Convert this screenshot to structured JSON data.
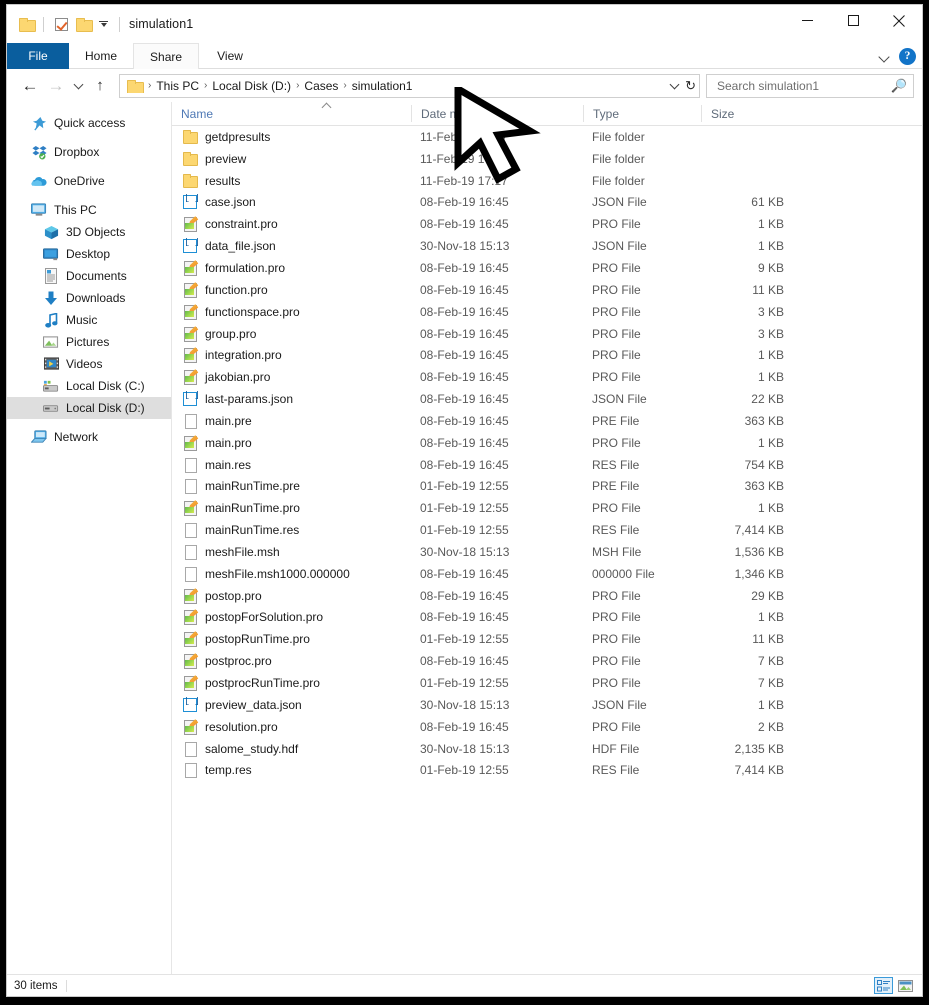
{
  "window": {
    "title": "simulation1",
    "quick_access": [
      "folder-icon",
      "properties-checkbox-icon",
      "new-folder-icon",
      "customize-chevron-icon"
    ],
    "controls": {
      "minimize": "–",
      "maximize": "☐",
      "close": "✕"
    }
  },
  "ribbon": {
    "tabs": [
      {
        "label": "File",
        "state": "file"
      },
      {
        "label": "Home",
        "state": "normal"
      },
      {
        "label": "Share",
        "state": "hover"
      },
      {
        "label": "View",
        "state": "normal"
      }
    ],
    "collapse_label": "⌄",
    "help_label": "?"
  },
  "address": {
    "back": "←",
    "forward": "→",
    "recent_caret": "⌄",
    "up": "↑",
    "crumbs": [
      "This PC",
      "Local Disk (D:)",
      "Cases",
      "simulation1"
    ],
    "separator": "›",
    "refresh": "↻"
  },
  "search": {
    "placeholder": "Search simulation1",
    "value": "",
    "icon": "search-icon"
  },
  "sidebar": {
    "items": [
      {
        "label": "Quick access",
        "icon": "pin-icon",
        "indent": false,
        "selected": false,
        "gap": false
      },
      {
        "label": "Dropbox",
        "icon": "dropbox-icon",
        "indent": false,
        "selected": false,
        "gap": true
      },
      {
        "label": "OneDrive",
        "icon": "onedrive-cloud-icon",
        "indent": false,
        "selected": false,
        "gap": true
      },
      {
        "label": "This PC",
        "icon": "monitor-icon",
        "indent": false,
        "selected": false,
        "gap": true
      },
      {
        "label": "3D Objects",
        "icon": "3d-objects-icon",
        "indent": true,
        "selected": false,
        "gap": false
      },
      {
        "label": "Desktop",
        "icon": "desktop-icon",
        "indent": true,
        "selected": false,
        "gap": false
      },
      {
        "label": "Documents",
        "icon": "documents-icon",
        "indent": true,
        "selected": false,
        "gap": false
      },
      {
        "label": "Downloads",
        "icon": "downloads-arrow-icon",
        "indent": true,
        "selected": false,
        "gap": false
      },
      {
        "label": "Music",
        "icon": "music-note-icon",
        "indent": true,
        "selected": false,
        "gap": false
      },
      {
        "label": "Pictures",
        "icon": "pictures-icon",
        "indent": true,
        "selected": false,
        "gap": false
      },
      {
        "label": "Videos",
        "icon": "videos-icon",
        "indent": true,
        "selected": false,
        "gap": false
      },
      {
        "label": "Local Disk (C:)",
        "icon": "system-drive-icon",
        "indent": true,
        "selected": false,
        "gap": false
      },
      {
        "label": "Local Disk (D:)",
        "icon": "drive-icon",
        "indent": true,
        "selected": true,
        "gap": false
      },
      {
        "label": "Network",
        "icon": "network-icon",
        "indent": false,
        "selected": false,
        "gap": true
      }
    ]
  },
  "filelist": {
    "columns": [
      "Name",
      "Date modified",
      "Type",
      "Size"
    ],
    "sorted_column": "Name",
    "sort_direction": "ascending",
    "rows": [
      {
        "name": "getdpresults",
        "date": "11-Feb-19 17:17",
        "type": "File folder",
        "size": "",
        "icon": "folder"
      },
      {
        "name": "preview",
        "date": "11-Feb-19 17:17",
        "type": "File folder",
        "size": "",
        "icon": "folder"
      },
      {
        "name": "results",
        "date": "11-Feb-19 17:17",
        "type": "File folder",
        "size": "",
        "icon": "folder"
      },
      {
        "name": "case.json",
        "date": "08-Feb-19 16:45",
        "type": "JSON File",
        "size": "61 KB",
        "icon": "json"
      },
      {
        "name": "constraint.pro",
        "date": "08-Feb-19 16:45",
        "type": "PRO File",
        "size": "1 KB",
        "icon": "pro"
      },
      {
        "name": "data_file.json",
        "date": "30-Nov-18 15:13",
        "type": "JSON File",
        "size": "1 KB",
        "icon": "json"
      },
      {
        "name": "formulation.pro",
        "date": "08-Feb-19 16:45",
        "type": "PRO File",
        "size": "9 KB",
        "icon": "pro"
      },
      {
        "name": "function.pro",
        "date": "08-Feb-19 16:45",
        "type": "PRO File",
        "size": "11 KB",
        "icon": "pro"
      },
      {
        "name": "functionspace.pro",
        "date": "08-Feb-19 16:45",
        "type": "PRO File",
        "size": "3 KB",
        "icon": "pro"
      },
      {
        "name": "group.pro",
        "date": "08-Feb-19 16:45",
        "type": "PRO File",
        "size": "3 KB",
        "icon": "pro"
      },
      {
        "name": "integration.pro",
        "date": "08-Feb-19 16:45",
        "type": "PRO File",
        "size": "1 KB",
        "icon": "pro"
      },
      {
        "name": "jakobian.pro",
        "date": "08-Feb-19 16:45",
        "type": "PRO File",
        "size": "1 KB",
        "icon": "pro"
      },
      {
        "name": "last-params.json",
        "date": "08-Feb-19 16:45",
        "type": "JSON File",
        "size": "22 KB",
        "icon": "json"
      },
      {
        "name": "main.pre",
        "date": "08-Feb-19 16:45",
        "type": "PRE File",
        "size": "363 KB",
        "icon": "doc"
      },
      {
        "name": "main.pro",
        "date": "08-Feb-19 16:45",
        "type": "PRO File",
        "size": "1 KB",
        "icon": "pro"
      },
      {
        "name": "main.res",
        "date": "08-Feb-19 16:45",
        "type": "RES File",
        "size": "754 KB",
        "icon": "doc"
      },
      {
        "name": "mainRunTime.pre",
        "date": "01-Feb-19 12:55",
        "type": "PRE File",
        "size": "363 KB",
        "icon": "doc"
      },
      {
        "name": "mainRunTime.pro",
        "date": "01-Feb-19 12:55",
        "type": "PRO File",
        "size": "1 KB",
        "icon": "pro"
      },
      {
        "name": "mainRunTime.res",
        "date": "01-Feb-19 12:55",
        "type": "RES File",
        "size": "7,414 KB",
        "icon": "doc"
      },
      {
        "name": "meshFile.msh",
        "date": "30-Nov-18 15:13",
        "type": "MSH File",
        "size": "1,536 KB",
        "icon": "doc"
      },
      {
        "name": "meshFile.msh1000.000000",
        "date": "08-Feb-19 16:45",
        "type": "000000 File",
        "size": "1,346 KB",
        "icon": "doc"
      },
      {
        "name": "postop.pro",
        "date": "08-Feb-19 16:45",
        "type": "PRO File",
        "size": "29 KB",
        "icon": "pro"
      },
      {
        "name": "postopForSolution.pro",
        "date": "08-Feb-19 16:45",
        "type": "PRO File",
        "size": "1 KB",
        "icon": "pro"
      },
      {
        "name": "postopRunTime.pro",
        "date": "01-Feb-19 12:55",
        "type": "PRO File",
        "size": "11 KB",
        "icon": "pro"
      },
      {
        "name": "postproc.pro",
        "date": "08-Feb-19 16:45",
        "type": "PRO File",
        "size": "7 KB",
        "icon": "pro"
      },
      {
        "name": "postprocRunTime.pro",
        "date": "01-Feb-19 12:55",
        "type": "PRO File",
        "size": "7 KB",
        "icon": "pro"
      },
      {
        "name": "preview_data.json",
        "date": "30-Nov-18 15:13",
        "type": "JSON File",
        "size": "1 KB",
        "icon": "json"
      },
      {
        "name": "resolution.pro",
        "date": "08-Feb-19 16:45",
        "type": "PRO File",
        "size": "2 KB",
        "icon": "pro"
      },
      {
        "name": "salome_study.hdf",
        "date": "30-Nov-18 15:13",
        "type": "HDF File",
        "size": "2,135 KB",
        "icon": "doc"
      },
      {
        "name": "temp.res",
        "date": "01-Feb-19 12:55",
        "type": "RES File",
        "size": "7,414 KB",
        "icon": "doc"
      }
    ]
  },
  "statusbar": {
    "item_count": "30 items",
    "views": [
      {
        "name": "details-view",
        "active": true
      },
      {
        "name": "large-icons-view",
        "active": false
      }
    ]
  },
  "colors": {
    "file_tab": "#0a5e9e",
    "accent_blue": "#1274c8",
    "folder_yellow": "#fcd771",
    "selection_gray": "#dedede"
  }
}
